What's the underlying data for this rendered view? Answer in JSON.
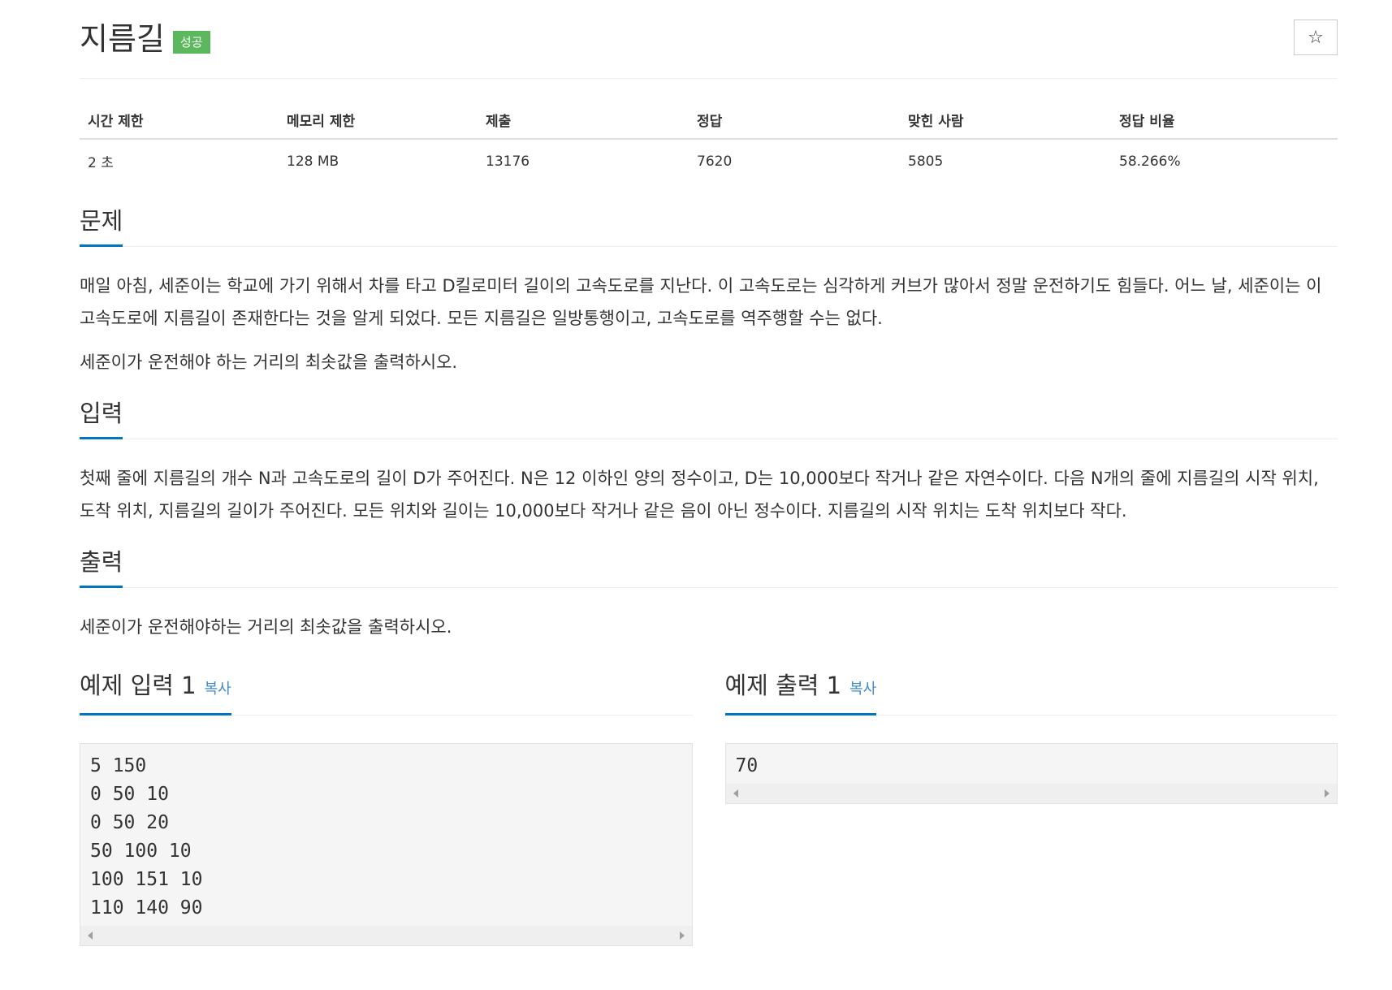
{
  "header": {
    "title": "지름길",
    "badge": "성공",
    "star_icon": "☆"
  },
  "info_table": {
    "headers": [
      "시간 제한",
      "메모리 제한",
      "제출",
      "정답",
      "맞힌 사람",
      "정답 비율"
    ],
    "values": [
      "2 초",
      "128 MB",
      "13176",
      "7620",
      "5805",
      "58.266%"
    ]
  },
  "problem": {
    "title": "문제",
    "paragraphs": [
      "매일 아침, 세준이는 학교에 가기 위해서 차를 타고 D킬로미터 길이의 고속도로를 지난다. 이 고속도로는 심각하게 커브가 많아서 정말 운전하기도 힘들다. 어느 날, 세준이는 이 고속도로에 지름길이 존재한다는 것을 알게 되었다. 모든 지름길은 일방통행이고, 고속도로를 역주행할 수는 없다.",
      "세준이가 운전해야 하는 거리의 최솟값을 출력하시오."
    ]
  },
  "input": {
    "title": "입력",
    "paragraphs": [
      "첫째 줄에 지름길의 개수 N과 고속도로의 길이 D가 주어진다. N은 12 이하인 양의 정수이고, D는 10,000보다 작거나 같은 자연수이다. 다음 N개의 줄에 지름길의 시작 위치, 도착 위치, 지름길의 길이가 주어진다. 모든 위치와 길이는 10,000보다 작거나 같은 음이 아닌 정수이다. 지름길의 시작 위치는 도착 위치보다 작다."
    ]
  },
  "output": {
    "title": "출력",
    "paragraphs": [
      "세준이가 운전해야하는 거리의 최솟값을 출력하시오."
    ]
  },
  "sample_input": {
    "title": "예제 입력 1",
    "copy_label": "복사",
    "lines": [
      "5 150",
      "0 50 10",
      "0 50 20",
      "50 100 10",
      "100 151 10",
      "110 140 90"
    ]
  },
  "sample_output": {
    "title": "예제 출력 1",
    "copy_label": "복사",
    "lines": [
      "70"
    ]
  }
}
